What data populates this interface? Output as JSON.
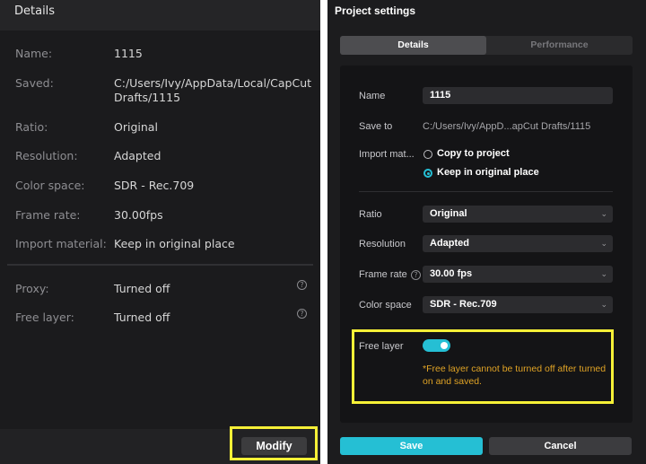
{
  "details_panel": {
    "header": "Details",
    "rows": [
      {
        "label": "Name:",
        "value": "1115"
      },
      {
        "label": "Saved:",
        "value": "C:/Users/Ivy/AppData/Local/CapCut Drafts/1115"
      },
      {
        "label": "Ratio:",
        "value": "Original"
      },
      {
        "label": "Resolution:",
        "value": "Adapted"
      },
      {
        "label": "Color space:",
        "value": "SDR - Rec.709"
      },
      {
        "label": "Frame rate:",
        "value": "30.00fps"
      },
      {
        "label": "Import material:",
        "value": "Keep in original place"
      }
    ],
    "extra_rows": [
      {
        "label": "Proxy:",
        "value": "Turned off",
        "help_icon": "?"
      },
      {
        "label": "Free layer:",
        "value": "Turned off",
        "help_icon": "?"
      }
    ],
    "modify_label": "Modify"
  },
  "project_settings": {
    "title": "Project settings",
    "tabs": [
      "Details",
      "Performance"
    ],
    "name_label": "Name",
    "name_value": "1115",
    "save_to_label": "Save to",
    "save_to_value": "C:/Users/Ivy/AppD...apCut Drafts/1115",
    "import_label": "Import mat...",
    "import_options": [
      "Copy to project",
      "Keep in original place"
    ],
    "import_selected": "Keep in original place",
    "ratio_label": "Ratio",
    "ratio_value": "Original",
    "resolution_label": "Resolution",
    "resolution_value": "Adapted",
    "frame_rate_label": "Frame rate",
    "frame_rate_value": "30.00 fps",
    "color_space_label": "Color space",
    "color_space_value": "SDR - Rec.709",
    "free_layer_label": "Free layer",
    "free_layer_on": true,
    "free_layer_warning": "*Free layer cannot be turned off after turned on and saved.",
    "save_label": "Save",
    "cancel_label": "Cancel",
    "chevron_glyph": "⌄"
  },
  "colors": {
    "accent": "#25bfd4",
    "highlight": "#f6f037",
    "warning": "#e0a325"
  }
}
